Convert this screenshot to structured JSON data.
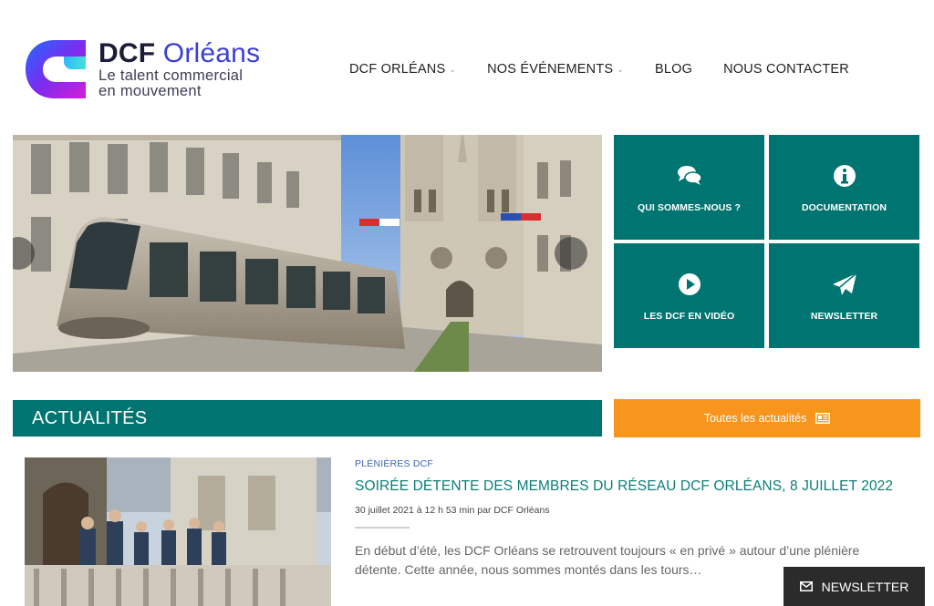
{
  "logo": {
    "title_part1": "DCF ",
    "title_part2": "Orléans",
    "tagline_line1": "Le talent commercial",
    "tagline_line2": "en mouvement"
  },
  "nav": {
    "items": [
      {
        "label": "DCF ORLÉANS",
        "has_dropdown": true
      },
      {
        "label": "NOS ÉVÉNEMENTS",
        "has_dropdown": true
      },
      {
        "label": "BLOG",
        "has_dropdown": false
      },
      {
        "label": "NOUS CONTACTER",
        "has_dropdown": false
      }
    ]
  },
  "tiles": [
    {
      "label": "QUI SOMMES-NOUS ?",
      "icon": "chat-bubbles-icon"
    },
    {
      "label": "DOCUMENTATION",
      "icon": "info-circle-icon"
    },
    {
      "label": "LES DCF EN VIDÉO",
      "icon": "play-circle-icon"
    },
    {
      "label": "NEWSLETTER",
      "icon": "paper-plane-icon"
    }
  ],
  "news": {
    "section_title": "ACTUALITÉS",
    "all_news_label": "Toutes les actualités"
  },
  "article": {
    "category": "PLÉNIÈRES DCF",
    "title": "SOIRÉE DÉTENTE DES MEMBRES DU RÉSEAU DCF ORLÉANS, 8 JUILLET 2022",
    "meta": "30 juillet 2021 à 12 h 53 min par DCF Orléans",
    "excerpt": "En début d’été, les DCF Orléans se retrouvent toujours « en privé » autour d’une plénière détente. Cette année, nous sommes montés dans les tours…"
  },
  "floating_newsletter": {
    "label": "NEWSLETTER"
  },
  "colors": {
    "teal": "#007470",
    "orange": "#f7951d",
    "dark": "#2b2b2b",
    "logo_blue": "#3a3fd6"
  }
}
